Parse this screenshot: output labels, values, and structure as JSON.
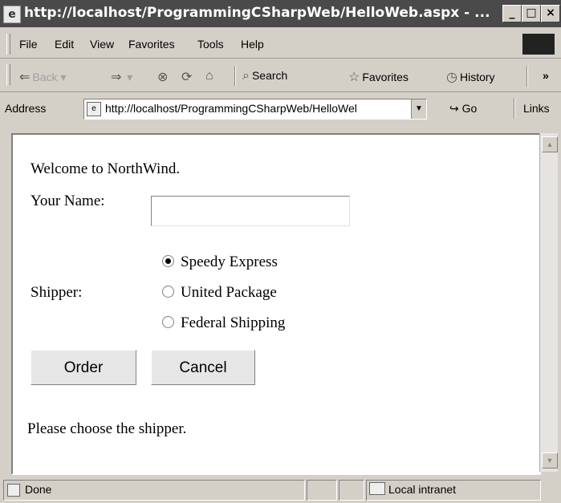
{
  "window": {
    "title": "http://localhost/ProgrammingCSharpWeb/HelloWeb.aspx - ..."
  },
  "menu": {
    "items": [
      "File",
      "Edit",
      "View",
      "Favorites",
      "Tools",
      "Help"
    ]
  },
  "toolbar": {
    "back": "Back",
    "search": "Search",
    "favorites": "Favorites",
    "history": "History",
    "more": "»"
  },
  "address": {
    "label": "Address",
    "value": "http://localhost/ProgrammingCSharpWeb/HelloWel",
    "go": "Go",
    "links": "Links"
  },
  "page": {
    "welcome": "Welcome to NorthWind.",
    "name_label": "Your Name:",
    "name_value": "",
    "shipper_label": "Shipper:",
    "shippers": [
      {
        "label": "Speedy Express",
        "selected": true
      },
      {
        "label": "United Package",
        "selected": false
      },
      {
        "label": "Federal Shipping",
        "selected": false
      }
    ],
    "order_button": "Order",
    "cancel_button": "Cancel",
    "message": "Please choose the shipper."
  },
  "status": {
    "text": "Done",
    "zone": "Local intranet"
  }
}
